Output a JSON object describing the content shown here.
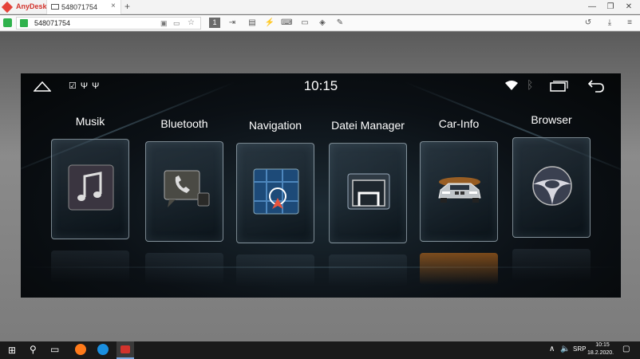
{
  "anydesk": {
    "app_name": "AnyDesk",
    "tab_label": "548071754",
    "tab_close": "×",
    "new_tab": "+",
    "address": "548071754",
    "window_controls": {
      "minimize": "—",
      "maximize": "❐",
      "close": "✕"
    },
    "toolbar_icons": [
      "monitor-1-icon",
      "transfer-icon",
      "chat-icon",
      "actions-icon",
      "keyboard-icon",
      "display-icon",
      "privacy-icon",
      "pen-icon",
      "history-icon",
      "download-icon",
      "menu-icon"
    ],
    "display_number": "1"
  },
  "car_screen": {
    "clock": "10:15",
    "status_icons_text": "☑ Ψ Ψ",
    "bluetooth_glyph": "ᛒ",
    "apps": [
      {
        "label": "Musik",
        "icon": "music-icon"
      },
      {
        "label": "Bluetooth",
        "icon": "phone-icon"
      },
      {
        "label": "Navigation",
        "icon": "navigation-icon"
      },
      {
        "label": "Datei Manager",
        "icon": "folder-icon"
      },
      {
        "label": "Car-Info",
        "icon": "car-icon"
      },
      {
        "label": "Browser",
        "icon": "browser-icon"
      }
    ]
  },
  "taskbar": {
    "time": "10:15",
    "date": "18.2.2020.",
    "language": "SRP",
    "tray_chevron": "∧"
  },
  "colors": {
    "anydesk_red": "#d2332c",
    "connected_green": "#2fb24c",
    "taskbar_bg": "#1a1a1a",
    "nav_arrow": "#e8553e",
    "car_glow": "#ff8a1a"
  }
}
